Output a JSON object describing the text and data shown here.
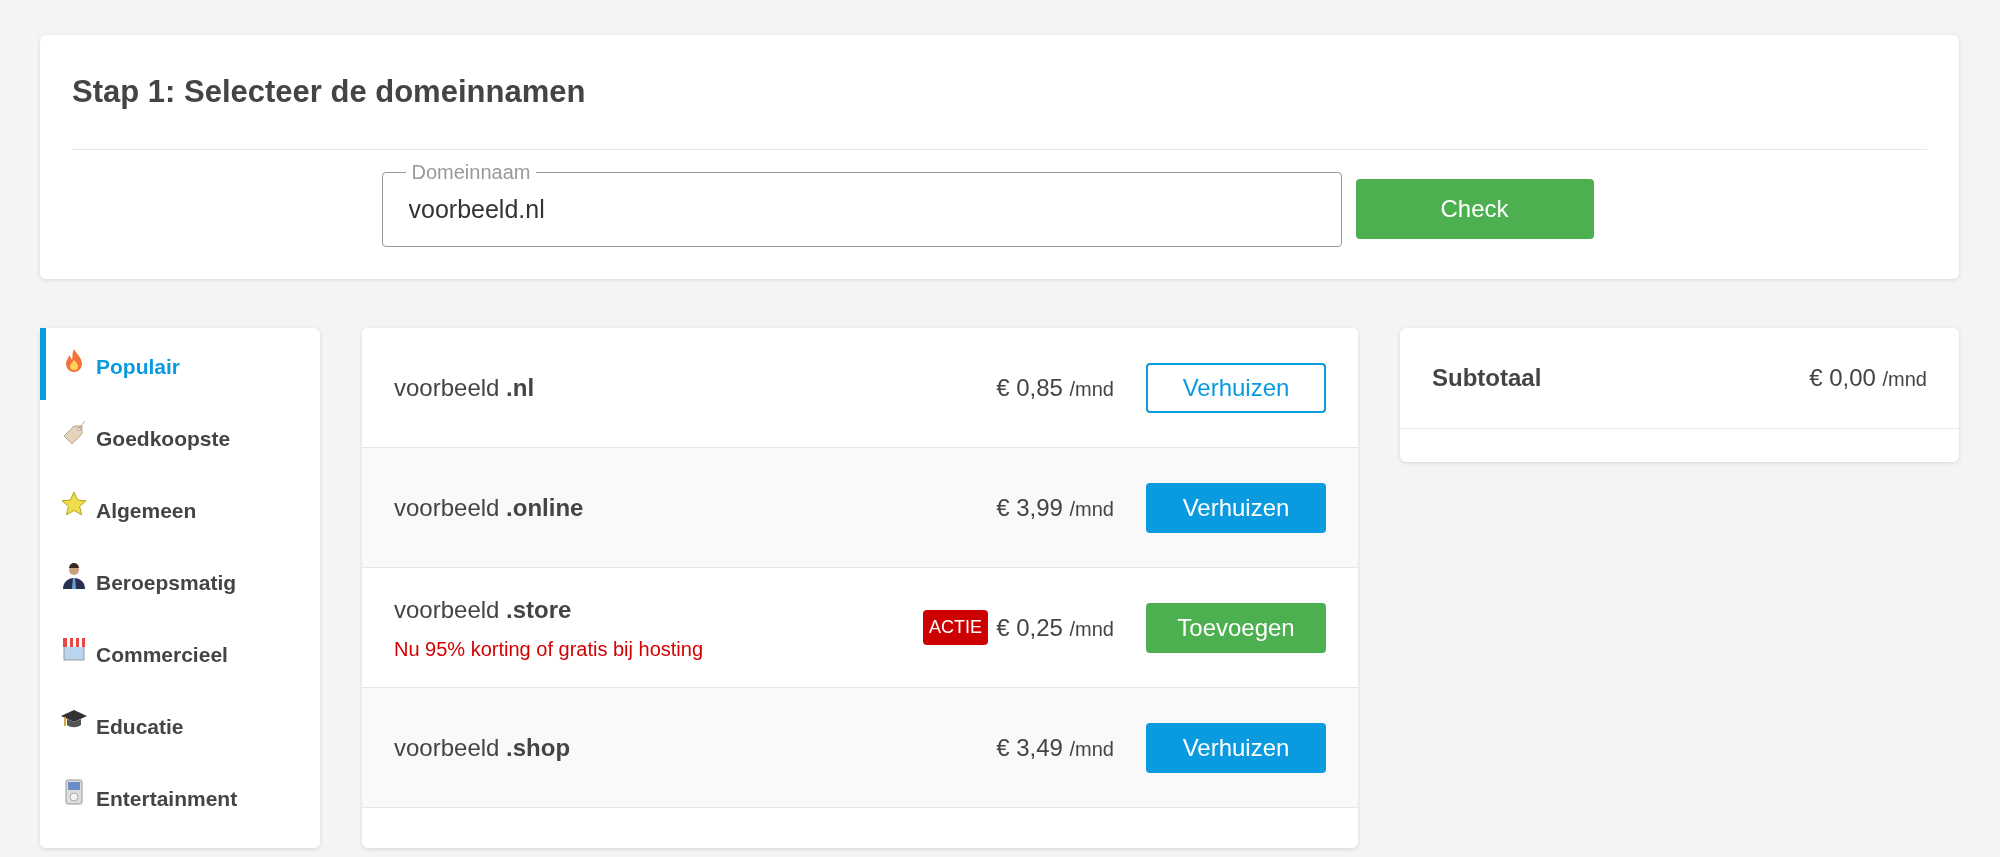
{
  "step": {
    "title": "Stap 1: Selecteer de domeinnamen",
    "field": {
      "label": "Domeinnaam",
      "value": "voorbeeld.nl"
    },
    "button": "Check"
  },
  "categories": [
    {
      "label": "Populair",
      "selected": true
    },
    {
      "label": "Goedkoopste",
      "selected": false
    },
    {
      "label": "Algemeen",
      "selected": false
    },
    {
      "label": "Beroepsmatig",
      "selected": false
    },
    {
      "label": "Commercieel",
      "selected": false
    },
    {
      "label": "Educatie",
      "selected": false
    },
    {
      "label": "Entertainment",
      "selected": false
    }
  ],
  "domains": [
    {
      "name": "voorbeeld",
      "tld": ".nl",
      "price": "€ 0,85",
      "unit": "/mnd",
      "button": "Verhuizen",
      "kind": "outline"
    },
    {
      "name": "voorbeeld",
      "tld": ".online",
      "price": "€ 3,99",
      "unit": "/mnd",
      "button": "Verhuizen",
      "kind": "primary"
    },
    {
      "name": "voorbeeld",
      "tld": ".store",
      "promo": "Nu 95% korting of gratis bij hosting",
      "badge": "ACTIE",
      "price": "€ 0,25",
      "unit": "/mnd",
      "button": "Toevoegen",
      "kind": "success"
    },
    {
      "name": "voorbeeld",
      "tld": ".shop",
      "price": "€ 3,49",
      "unit": "/mnd",
      "button": "Verhuizen",
      "kind": "primary"
    }
  ],
  "summary": {
    "label": "Subtotaal",
    "price": "€ 0,00",
    "unit": "/mnd"
  }
}
